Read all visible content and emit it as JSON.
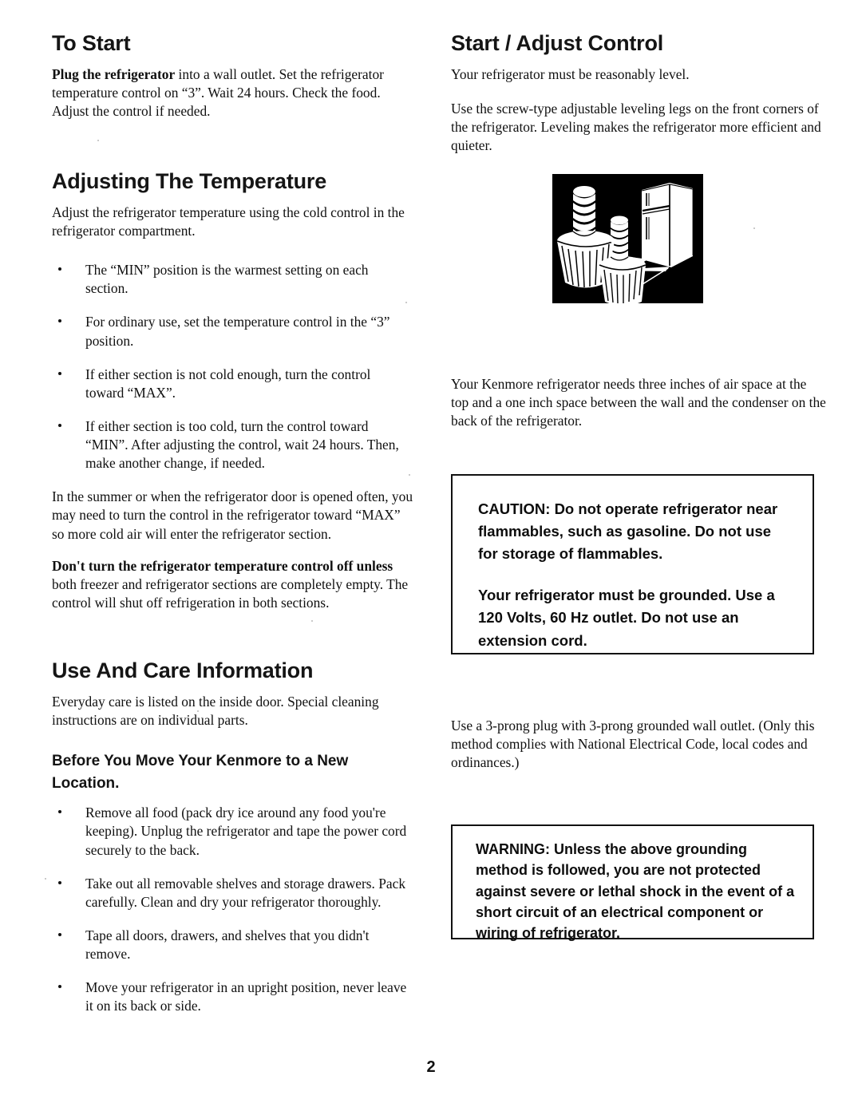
{
  "document": {
    "page_number": "2"
  },
  "left_column": {
    "to_start": {
      "heading": "To Start",
      "paragraph_bold": "Plug the refrigerator",
      "paragraph_rest": " into a wall outlet. Set the refrigerator temperature control on “3”. Wait 24 hours. Check the food. Adjust the control if needed."
    },
    "adjusting_temperature": {
      "heading": "Adjusting The Temperature",
      "intro": "Adjust the refrigerator temperature using the cold control in the refrigerator compartment.",
      "bullets": [
        "The “MIN” position is the warmest setting on each section.",
        "For ordinary use, set the temperature control in the “3” position.",
        "If either section is not cold enough, turn the control toward “MAX”.",
        "If either section is too cold, turn the control toward “MIN”.  After adjusting the control, wait 24 hours. Then, make another change, if needed."
      ],
      "summer_paragraph": "In the summer or when the refrigerator door is opened often, you may need to turn the control in the refrigerator toward “MAX” so more cold air will enter the refrigerator section.",
      "dont_turn_off_bold": "Don't turn the refrigerator temperature control off unless",
      "dont_turn_off_rest": " both freezer and refrigerator sections are completely empty. The control will shut off refrigeration in both sections."
    },
    "use_and_care": {
      "heading": "Use And Care Information",
      "intro": "Everyday care is listed on the inside door. Special cleaning instructions are on individual parts.",
      "move_subheading": "Before You Move Your Kenmore to a New Location.",
      "bullets": [
        "Remove all food (pack dry ice around any food you're keeping). Unplug the refrigerator and tape the power cord securely to the back.",
        "Take out all removable shelves and storage drawers. Pack carefully. Clean and dry your refrigerator thoroughly.",
        "Tape all doors, drawers, and shelves that you didn't remove.",
        "Move your refrigerator in an upright position, never leave it on its back or side."
      ]
    }
  },
  "right_column": {
    "start_adjust_control": {
      "heading": "Start / Adjust Control",
      "paragraph_1": "Your refrigerator must be reasonably level.",
      "paragraph_2": "Use the screw-type adjustable leveling legs on the front corners of the refrigerator. Leveling makes the refrigerator more efficient and quieter."
    },
    "figure": {
      "name": "leveling-legs-illustration",
      "caption": ""
    },
    "air_space_paragraph": "Your Kenmore refrigerator needs three inches of air space at the top and a one inch space between the wall and the condenser on the back of the refrigerator.",
    "caution_box": {
      "line_1": "CAUTION: Do not operate refrigerator near flammables, such as gasoline. Do not use for storage of flammables.",
      "line_2": "Your refrigerator must be grounded. Use a 120 Volts, 60 Hz outlet. Do not use an extension cord."
    },
    "plug_paragraph": "Use a 3-prong plug with 3-prong grounded wall outlet. (Only this method complies with National Electrical Code, local codes and ordinances.)",
    "warning_box": {
      "text": "WARNING: Unless the above grounding method is followed, you are not protected against severe or lethal shock in the event of a short circuit of an electrical component or wiring of refrigerator."
    }
  },
  "colors": {
    "ink": "#101010",
    "figure_background": "#000000",
    "figure_foreground": "#ffffff",
    "paper": "#ffffff"
  }
}
